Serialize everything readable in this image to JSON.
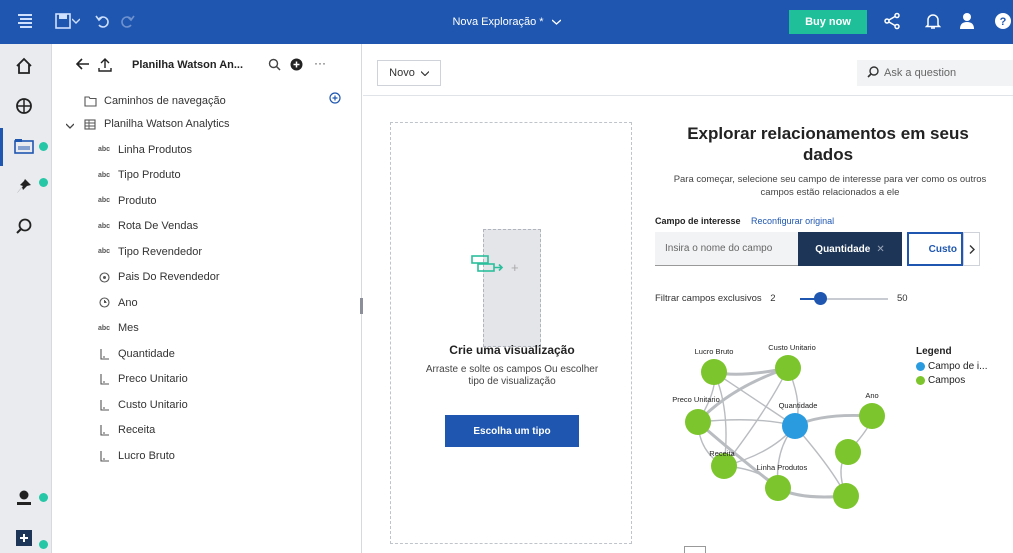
{
  "topbar": {
    "title": "Nova Exploração *",
    "buy_label": "Buy now"
  },
  "panel": {
    "source_title": "Planilha Watson An...",
    "tree": [
      {
        "label": "Caminhos de navegação",
        "icon": "folder-icon",
        "indent": 0
      },
      {
        "label": "Planilha Watson Analytics",
        "icon": "table-icon",
        "indent": 0
      },
      {
        "label": "Linha Produtos",
        "icon": "text-field-icon",
        "indent": 1
      },
      {
        "label": "Tipo Produto",
        "icon": "text-field-icon",
        "indent": 1
      },
      {
        "label": "Produto",
        "icon": "text-field-icon",
        "indent": 1
      },
      {
        "label": "Rota De Vendas",
        "icon": "text-field-icon",
        "indent": 1
      },
      {
        "label": "Tipo Revendedor",
        "icon": "text-field-icon",
        "indent": 1
      },
      {
        "label": "Pais Do Revendedor",
        "icon": "geo-field-icon",
        "indent": 1
      },
      {
        "label": "Ano",
        "icon": "time-field-icon",
        "indent": 1
      },
      {
        "label": "Mes",
        "icon": "text-field-icon",
        "indent": 1
      },
      {
        "label": "Quantidade",
        "icon": "measure-field-icon",
        "indent": 1
      },
      {
        "label": "Preco Unitario",
        "icon": "measure-field-icon",
        "indent": 1
      },
      {
        "label": "Custo Unitario",
        "icon": "measure-field-icon",
        "indent": 1
      },
      {
        "label": "Receita",
        "icon": "measure-field-icon",
        "indent": 1
      },
      {
        "label": "Lucro Bruto",
        "icon": "measure-field-icon",
        "indent": 1
      }
    ]
  },
  "main": {
    "new_label": "Novo",
    "ask_placeholder": "Ask a question",
    "dropzone": {
      "title": "Crie uma visualização",
      "subtitle": "Arraste e solte os campos Ou escolher tipo de visualização",
      "button": "Escolha um tipo"
    },
    "explore": {
      "title": "Explorar relacionamentos em seus dados",
      "subtitle": "Para começar, selecione seu campo de interesse para ver como os outros campos estão relacionados a ele",
      "field_label": "Campo de interesse",
      "reset_link": "Reconfigurar original",
      "input_placeholder": "Insira o nome do campo",
      "chip_selected": "Quantidade",
      "chip_next": "Custo",
      "filter_label": "Filtrar campos exclusivos",
      "filter_min": "2",
      "filter_max": "50",
      "filter_value": 2
    },
    "network": {
      "nodes": [
        {
          "id": "lucro",
          "label": "Lucro Bruto",
          "type": "field"
        },
        {
          "id": "custo",
          "label": "Custo Unitario",
          "type": "field"
        },
        {
          "id": "preco",
          "label": "Preco Unitario",
          "type": "field"
        },
        {
          "id": "quant",
          "label": "Quantidade",
          "type": "focus"
        },
        {
          "id": "ano",
          "label": "Ano",
          "type": "field"
        },
        {
          "id": "receita",
          "label": "Receita",
          "type": "field"
        },
        {
          "id": "linha",
          "label": "Linha Produtos",
          "type": "field"
        },
        {
          "id": "n8",
          "label": "",
          "type": "field"
        },
        {
          "id": "n9",
          "label": "",
          "type": "field"
        }
      ],
      "edges": [
        [
          "lucro",
          "custo"
        ],
        [
          "lucro",
          "preco"
        ],
        [
          "lucro",
          "quant"
        ],
        [
          "custo",
          "quant"
        ],
        [
          "custo",
          "preco"
        ],
        [
          "preco",
          "quant"
        ],
        [
          "preco",
          "receita"
        ],
        [
          "custo",
          "receita"
        ],
        [
          "quant",
          "ano"
        ],
        [
          "quant",
          "receita"
        ],
        [
          "quant",
          "linha"
        ],
        [
          "receita",
          "linha"
        ],
        [
          "linha",
          "n8"
        ],
        [
          "ano",
          "n9"
        ],
        [
          "n8",
          "n9"
        ],
        [
          "quant",
          "n8"
        ],
        [
          "preco",
          "linha"
        ],
        [
          "lucro",
          "receita"
        ]
      ],
      "colors": {
        "focus": "#2b9be0",
        "field": "#7cc52c"
      }
    },
    "legend": {
      "title": "Legend",
      "items": [
        "Campo de i...",
        "Campos"
      ]
    }
  }
}
